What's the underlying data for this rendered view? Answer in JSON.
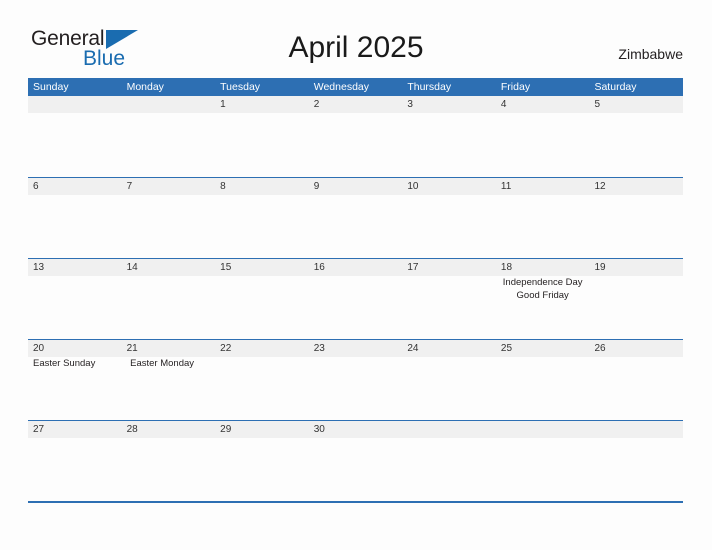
{
  "brand": {
    "name_part1": "General",
    "name_part2": "Blue",
    "triangle_icon": "triangle-logo-icon",
    "primary_color": "#1a6cb0"
  },
  "header": {
    "title": "April 2025",
    "country": "Zimbabwe"
  },
  "theme": {
    "header_blue": "#2d6fb3",
    "date_band_gray": "#f0f0f0",
    "page_background": "#fdfdfd",
    "text_color": "#231f20"
  },
  "calendar": {
    "month": "April",
    "year": "2025",
    "weekday_headers": [
      "Sunday",
      "Monday",
      "Tuesday",
      "Wednesday",
      "Thursday",
      "Friday",
      "Saturday"
    ],
    "weeks": [
      {
        "days": [
          {
            "date": "",
            "events": []
          },
          {
            "date": "",
            "events": []
          },
          {
            "date": "1",
            "events": []
          },
          {
            "date": "2",
            "events": []
          },
          {
            "date": "3",
            "events": []
          },
          {
            "date": "4",
            "events": []
          },
          {
            "date": "5",
            "events": []
          }
        ]
      },
      {
        "days": [
          {
            "date": "6",
            "events": []
          },
          {
            "date": "7",
            "events": []
          },
          {
            "date": "8",
            "events": []
          },
          {
            "date": "9",
            "events": []
          },
          {
            "date": "10",
            "events": []
          },
          {
            "date": "11",
            "events": []
          },
          {
            "date": "12",
            "events": []
          }
        ]
      },
      {
        "days": [
          {
            "date": "13",
            "events": []
          },
          {
            "date": "14",
            "events": []
          },
          {
            "date": "15",
            "events": []
          },
          {
            "date": "16",
            "events": []
          },
          {
            "date": "17",
            "events": []
          },
          {
            "date": "18",
            "events": [
              "Independence Day",
              "Good Friday"
            ]
          },
          {
            "date": "19",
            "events": []
          }
        ]
      },
      {
        "days": [
          {
            "date": "20",
            "events": [
              "Easter Sunday"
            ],
            "align": "left"
          },
          {
            "date": "21",
            "events": [
              "Easter Monday"
            ],
            "align": "left"
          },
          {
            "date": "22",
            "events": []
          },
          {
            "date": "23",
            "events": []
          },
          {
            "date": "24",
            "events": []
          },
          {
            "date": "25",
            "events": []
          },
          {
            "date": "26",
            "events": []
          }
        ]
      },
      {
        "days": [
          {
            "date": "27",
            "events": []
          },
          {
            "date": "28",
            "events": []
          },
          {
            "date": "29",
            "events": []
          },
          {
            "date": "30",
            "events": []
          },
          {
            "date": "",
            "events": []
          },
          {
            "date": "",
            "events": []
          },
          {
            "date": "",
            "events": []
          }
        ]
      }
    ]
  }
}
